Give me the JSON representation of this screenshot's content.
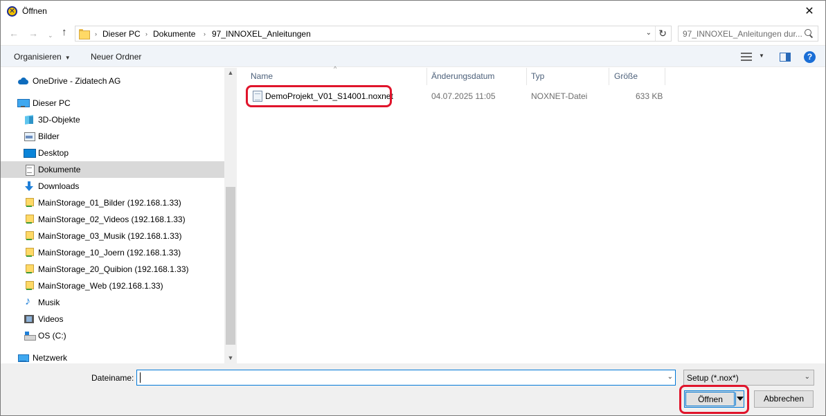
{
  "window": {
    "title": "Öffnen",
    "close_glyph": "✕"
  },
  "navigation": {
    "back_glyph": "←",
    "forward_glyph": "→",
    "recent_glyph": "⌄",
    "up_glyph": "↑",
    "breadcrumb": [
      "Dieser PC",
      "Dokumente",
      "97_INNOXEL_Anleitungen"
    ],
    "breadcrumb_sep": "›",
    "dropdown_glyph": "⌄",
    "refresh_glyph": "↻",
    "search_placeholder": "97_INNOXEL_Anleitungen dur..."
  },
  "commandbar": {
    "organize_label": "Organisieren",
    "organize_caret": "▼",
    "new_folder_label": "Neuer Ordner",
    "view_caret": "▼",
    "help_glyph": "?"
  },
  "navpane": {
    "items": [
      {
        "label": "OneDrive - Zidatech AG",
        "icon": "onedrive-icon"
      },
      {
        "label": "Dieser PC",
        "icon": "computer-icon"
      },
      {
        "label": "3D-Objekte",
        "icon": "3d-objects-icon"
      },
      {
        "label": "Bilder",
        "icon": "pictures-icon"
      },
      {
        "label": "Desktop",
        "icon": "desktop-icon"
      },
      {
        "label": "Dokumente",
        "icon": "documents-icon",
        "selected": true
      },
      {
        "label": "Downloads",
        "icon": "downloads-icon"
      },
      {
        "label": "MainStorage_01_Bilder (192.168.1.33)",
        "icon": "network-drive-icon"
      },
      {
        "label": "MainStorage_02_Videos (192.168.1.33)",
        "icon": "network-drive-icon"
      },
      {
        "label": "MainStorage_03_Musik (192.168.1.33)",
        "icon": "network-drive-icon"
      },
      {
        "label": "MainStorage_10_Joern (192.168.1.33)",
        "icon": "network-drive-icon"
      },
      {
        "label": "MainStorage_20_Quibion (192.168.1.33)",
        "icon": "network-drive-icon"
      },
      {
        "label": "MainStorage_Web (192.168.1.33)",
        "icon": "network-drive-icon"
      },
      {
        "label": "Musik",
        "icon": "music-icon"
      },
      {
        "label": "Videos",
        "icon": "videos-icon"
      },
      {
        "label": "OS (C:)",
        "icon": "drive-icon"
      },
      {
        "label": "Netzwerk",
        "icon": "network-icon"
      }
    ],
    "scroll_up_glyph": "▲",
    "scroll_down_glyph": "▼"
  },
  "filelist": {
    "columns": [
      "Name",
      "Änderungsdatum",
      "Typ",
      "Größe"
    ],
    "sort_glyph": "^",
    "rows": [
      {
        "name": "DemoProjekt_V01_S14001.noxnet",
        "modified": "04.07.2025 11:05",
        "type": "NOXNET-Datei",
        "size": "633 KB"
      }
    ]
  },
  "footer": {
    "filename_label": "Dateiname:",
    "filename_value": "",
    "filename_dropdown_glyph": "⌄",
    "filter_value": "Setup (*.nox*)",
    "filter_dropdown_glyph": "⌄",
    "open_label": "Öffnen",
    "cancel_label": "Abbrechen"
  },
  "colors": {
    "highlight": "#e0142b",
    "accent": "#0078d7"
  }
}
